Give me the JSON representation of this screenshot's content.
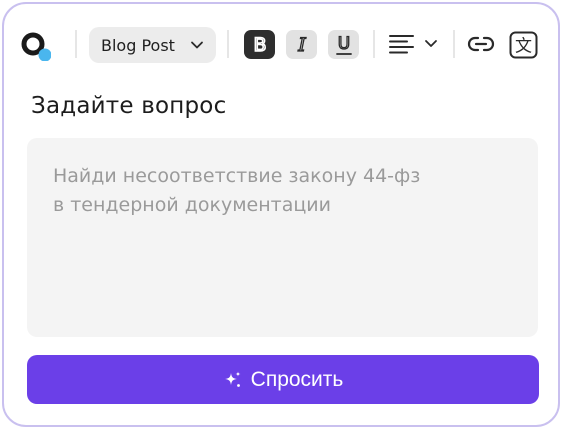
{
  "toolbar": {
    "logo_icon": "assistant-logo-icon",
    "format_dropdown": {
      "selected": "Blog Post"
    },
    "bold": {
      "glyph": "B",
      "icon": "bold-icon"
    },
    "italic": {
      "glyph": "I",
      "icon": "italic-icon"
    },
    "underline": {
      "glyph": "U",
      "icon": "underline-icon"
    },
    "align_icon": "align-left-icon",
    "link_icon": "link-icon",
    "translate_icon": "translate-icon",
    "translate_glyph": "文"
  },
  "form": {
    "heading": "Задайте вопрос",
    "placeholder": "Найди несоответствие закону 44-фз\nв тендерной документации",
    "submit_label": "Спросить",
    "submit_icon": "sparkle-icon"
  },
  "colors": {
    "accent": "#6b3fe8",
    "logo_dot": "#4ab6ee",
    "border": "#c9c0ef",
    "input_bg": "#f4f4f4",
    "placeholder": "#9a9a9a"
  }
}
